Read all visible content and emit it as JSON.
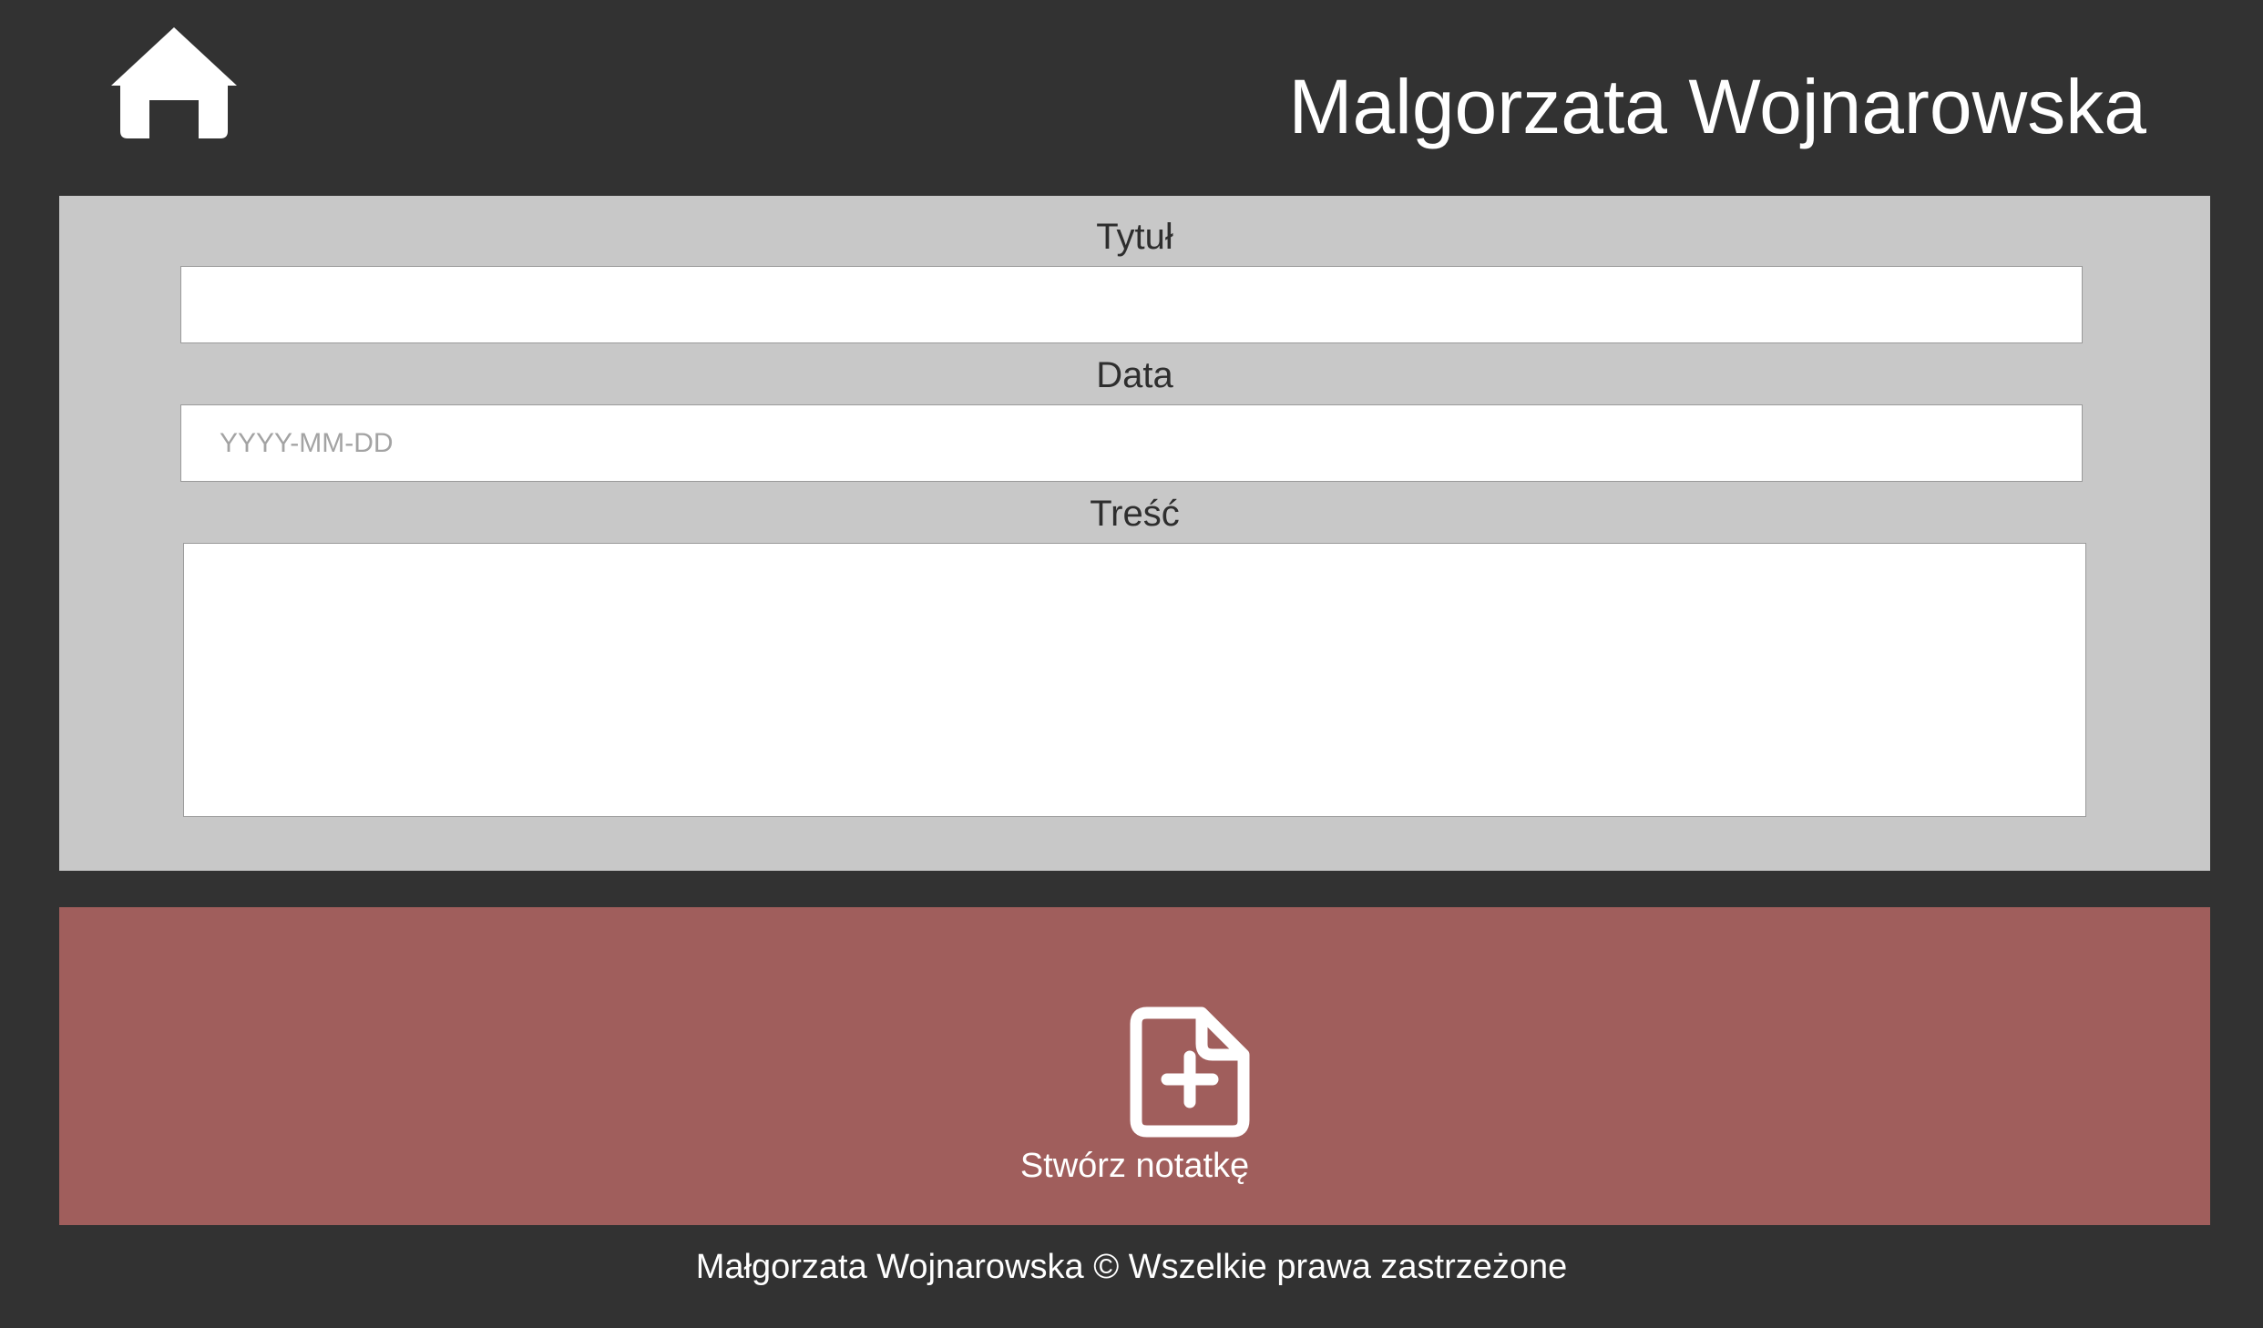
{
  "header": {
    "home_icon": "home-icon",
    "title": "Malgorzata Wojnarowska"
  },
  "form": {
    "title_label": "Tytuł",
    "title_value": "",
    "date_label": "Data",
    "date_placeholder": "YYYY-MM-DD",
    "date_value": "",
    "content_label": "Treść",
    "content_value": ""
  },
  "create_button": {
    "icon": "add-file-icon",
    "label": "Stwórz notatkę"
  },
  "footer": {
    "text": "Małgorzata Wojnarowska © Wszelkie prawa zastrzeżone"
  },
  "colors": {
    "background": "#323232",
    "panel": "#c8c8c8",
    "accent": "#a05e5c",
    "text_light": "#ffffff",
    "text_dark": "#2e2e2e"
  }
}
